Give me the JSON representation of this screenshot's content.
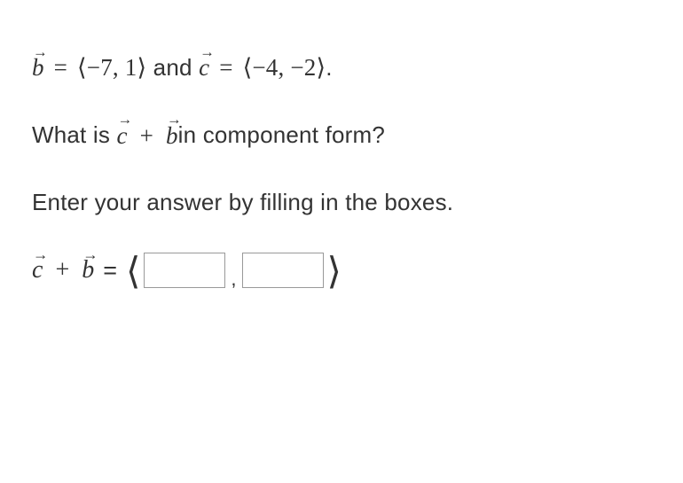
{
  "problem": {
    "given": {
      "b_label": "b",
      "b_components": "⟨−7, 1⟩",
      "and_text": " and ",
      "c_label": "c",
      "c_components": "⟨−4, −2⟩",
      "period": "."
    },
    "question": {
      "prefix": "What is ",
      "expr_c": "c",
      "plus": " + ",
      "expr_b": "b",
      "suffix": " in component form?"
    },
    "instruction": "Enter your answer by filling in the boxes.",
    "answer": {
      "lhs_c": "c",
      "plus": " + ",
      "lhs_b": "b",
      "equals": "=",
      "left_bracket": "⟨",
      "comma": ",",
      "right_bracket": "⟩",
      "input1_value": "",
      "input2_value": ""
    }
  }
}
